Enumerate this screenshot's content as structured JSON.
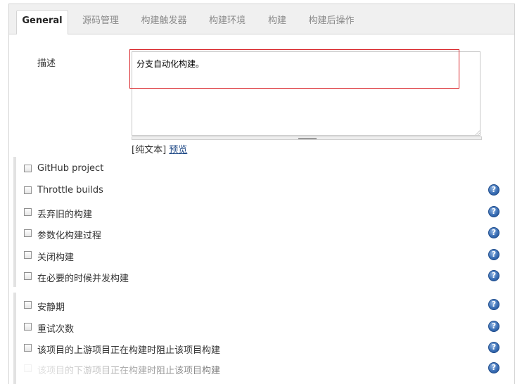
{
  "tabs": [
    {
      "label": "General"
    },
    {
      "label": "源码管理"
    },
    {
      "label": "构建触发器"
    },
    {
      "label": "构建环境"
    },
    {
      "label": "构建"
    },
    {
      "label": "构建后操作"
    }
  ],
  "description": {
    "label": "描述",
    "value": "分支自动化构建。",
    "plain_text_prefix": "[纯文本] ",
    "preview_link": "预览"
  },
  "options_group1": [
    {
      "label": "GitHub project",
      "help": false
    },
    {
      "label": "Throttle builds",
      "help": true
    },
    {
      "label": "丢弃旧的构建",
      "help": true
    },
    {
      "label": "参数化构建过程",
      "help": true
    },
    {
      "label": "关闭构建",
      "help": true
    },
    {
      "label": "在必要的时候并发构建",
      "help": true
    }
  ],
  "options_group2": [
    {
      "label": "安静期",
      "help": true
    },
    {
      "label": "重试次数",
      "help": true
    },
    {
      "label": "该项目的上游项目正在构建时阻止该项目构建",
      "help": true
    },
    {
      "label": "该项目的下游项目正在构建时阻止该项目构建",
      "help": true
    }
  ],
  "help_glyph": "?",
  "colors": {
    "highlight_border": "#d9262b",
    "link": "#204a87",
    "help_icon": "#3b6fb5"
  }
}
